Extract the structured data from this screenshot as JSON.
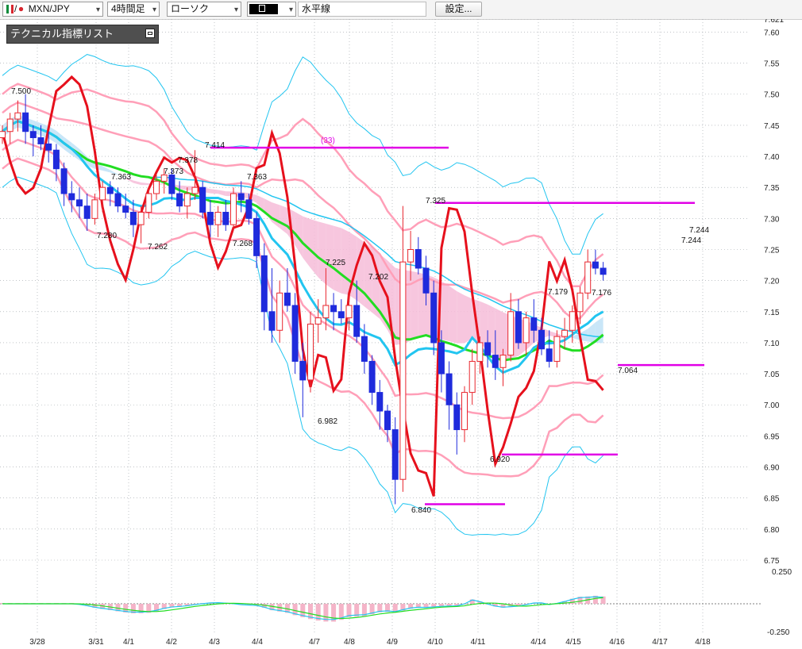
{
  "toolbar": {
    "symbol": "MXN/JPY",
    "timeframe": "4時間足",
    "chart_style": "ローソク",
    "drawing_tool": "水平線",
    "settings_label": "設定..."
  },
  "panel": {
    "title": "テクニカル指標リスト"
  },
  "chart_data": {
    "type": "candlestick",
    "symbol": "MXN/JPY",
    "timeframe": "4時間足",
    "ylim": [
      6.75,
      7.621
    ],
    "y_ticks": [
      "7.621",
      "7.60",
      "7.55",
      "7.50",
      "7.45",
      "7.40",
      "7.35",
      "7.30",
      "7.25",
      "7.20",
      "7.15",
      "7.10",
      "7.05",
      "7.00",
      "6.95",
      "6.90",
      "6.85",
      "6.80",
      "6.75"
    ],
    "x_labels": [
      "3/28",
      "3/31",
      "4/1",
      "4/2",
      "4/3",
      "4/4",
      "4/7",
      "4/8",
      "4/9",
      "4/10",
      "4/11",
      "4/14",
      "4/15",
      "4/16",
      "4/17",
      "4/18"
    ],
    "annotations": [
      "7.500",
      "7.363",
      "7.373",
      "7.378",
      "7.414",
      "7.363",
      "7.280",
      "7.262",
      "7.268",
      "7.225",
      "7.202",
      "6.982",
      "7.325",
      "6.840",
      "6.920",
      "7.179",
      "7.176",
      "7.064",
      "7.244",
      "7.244",
      "(33)"
    ],
    "horizontal_lines": [
      7.414,
      7.325,
      7.064,
      6.92,
      6.84
    ],
    "candles": [
      [
        7.43,
        7.45,
        7.42,
        7.44
      ],
      [
        7.44,
        7.47,
        7.42,
        7.46
      ],
      [
        7.46,
        7.49,
        7.44,
        7.47
      ],
      [
        7.47,
        7.5,
        7.42,
        7.44
      ],
      [
        7.44,
        7.45,
        7.4,
        7.43
      ],
      [
        7.43,
        7.45,
        7.41,
        7.42
      ],
      [
        7.42,
        7.44,
        7.39,
        7.41
      ],
      [
        7.41,
        7.42,
        7.36,
        7.38
      ],
      [
        7.38,
        7.39,
        7.32,
        7.34
      ],
      [
        7.34,
        7.36,
        7.31,
        7.33
      ],
      [
        7.33,
        7.35,
        7.3,
        7.32
      ],
      [
        7.32,
        7.34,
        7.28,
        7.3
      ],
      [
        7.3,
        7.34,
        7.29,
        7.33
      ],
      [
        7.33,
        7.36,
        7.31,
        7.35
      ],
      [
        7.35,
        7.36,
        7.32,
        7.34
      ],
      [
        7.34,
        7.35,
        7.31,
        7.32
      ],
      [
        7.32,
        7.34,
        7.3,
        7.31
      ],
      [
        7.31,
        7.33,
        7.27,
        7.29
      ],
      [
        7.29,
        7.32,
        7.26,
        7.31
      ],
      [
        7.31,
        7.35,
        7.3,
        7.34
      ],
      [
        7.34,
        7.37,
        7.33,
        7.36
      ],
      [
        7.36,
        7.38,
        7.34,
        7.37
      ],
      [
        7.37,
        7.38,
        7.33,
        7.34
      ],
      [
        7.34,
        7.36,
        7.31,
        7.32
      ],
      [
        7.32,
        7.35,
        7.3,
        7.34
      ],
      [
        7.34,
        7.41,
        7.33,
        7.35
      ],
      [
        7.35,
        7.36,
        7.3,
        7.31
      ],
      [
        7.31,
        7.33,
        7.27,
        7.29
      ],
      [
        7.29,
        7.32,
        7.27,
        7.31
      ],
      [
        7.31,
        7.33,
        7.28,
        7.29
      ],
      [
        7.29,
        7.35,
        7.28,
        7.34
      ],
      [
        7.34,
        7.36,
        7.31,
        7.33
      ],
      [
        7.33,
        7.34,
        7.29,
        7.3
      ],
      [
        7.3,
        7.31,
        7.22,
        7.24
      ],
      [
        7.24,
        7.26,
        7.12,
        7.15
      ],
      [
        7.15,
        7.22,
        7.1,
        7.12
      ],
      [
        7.12,
        7.2,
        7.1,
        7.18
      ],
      [
        7.18,
        7.22,
        7.15,
        7.16
      ],
      [
        7.16,
        7.18,
        7.05,
        7.07
      ],
      [
        7.07,
        7.1,
        6.98,
        7.04
      ],
      [
        7.04,
        7.15,
        7.02,
        7.13
      ],
      [
        7.13,
        7.17,
        7.1,
        7.14
      ],
      [
        7.14,
        7.22,
        7.12,
        7.16
      ],
      [
        7.16,
        7.18,
        7.12,
        7.15
      ],
      [
        7.15,
        7.17,
        7.13,
        7.14
      ],
      [
        7.14,
        7.18,
        7.12,
        7.16
      ],
      [
        7.16,
        7.2,
        7.1,
        7.11
      ],
      [
        7.11,
        7.13,
        7.05,
        7.07
      ],
      [
        7.07,
        7.08,
        7.0,
        7.02
      ],
      [
        7.02,
        7.04,
        6.96,
        6.99
      ],
      [
        6.99,
        7.0,
        6.94,
        6.96
      ],
      [
        6.96,
        6.98,
        6.84,
        6.88
      ],
      [
        6.88,
        7.32,
        6.86,
        7.23
      ],
      [
        7.23,
        7.28,
        7.2,
        7.25
      ],
      [
        7.25,
        7.27,
        7.21,
        7.22
      ],
      [
        7.22,
        7.24,
        7.16,
        7.18
      ],
      [
        7.18,
        7.2,
        7.08,
        7.1
      ],
      [
        7.1,
        7.12,
        7.02,
        7.05
      ],
      [
        7.05,
        7.07,
        6.96,
        7.0
      ],
      [
        7.0,
        7.02,
        6.92,
        6.96
      ],
      [
        6.96,
        7.03,
        6.94,
        7.02
      ],
      [
        7.02,
        7.09,
        7.0,
        7.07
      ],
      [
        7.07,
        7.11,
        7.05,
        7.1
      ],
      [
        7.1,
        7.12,
        7.06,
        7.08
      ],
      [
        7.08,
        7.12,
        7.04,
        7.06
      ],
      [
        7.06,
        7.09,
        7.03,
        7.08
      ],
      [
        7.08,
        7.18,
        7.07,
        7.15
      ],
      [
        7.15,
        7.17,
        7.09,
        7.1
      ],
      [
        7.1,
        7.15,
        7.08,
        7.14
      ],
      [
        7.14,
        7.17,
        7.1,
        7.12
      ],
      [
        7.12,
        7.14,
        7.08,
        7.09
      ],
      [
        7.09,
        7.12,
        7.06,
        7.07
      ],
      [
        7.07,
        7.12,
        7.06,
        7.11
      ],
      [
        7.11,
        7.14,
        7.09,
        7.12
      ],
      [
        7.12,
        7.16,
        7.1,
        7.15
      ],
      [
        7.15,
        7.19,
        7.13,
        7.18
      ],
      [
        7.18,
        7.25,
        7.17,
        7.23
      ],
      [
        7.23,
        7.25,
        7.21,
        7.22
      ],
      [
        7.22,
        7.23,
        7.2,
        7.21
      ]
    ]
  },
  "colors": {
    "bull": "#e8262e",
    "bear": "#1f2bdc",
    "grid": "#9aa0a6",
    "hline": "#e100e6",
    "red_line": "#e6101c",
    "green_line": "#22dd22",
    "cyan_line": "#22c5f0",
    "pink_line": "#ff9fb8",
    "cloud_pink": "#f6bcd8",
    "cloud_blue": "#bfe2f7"
  },
  "oscillator": {
    "upper_label": "0.250",
    "lower_label": "-0.250"
  }
}
